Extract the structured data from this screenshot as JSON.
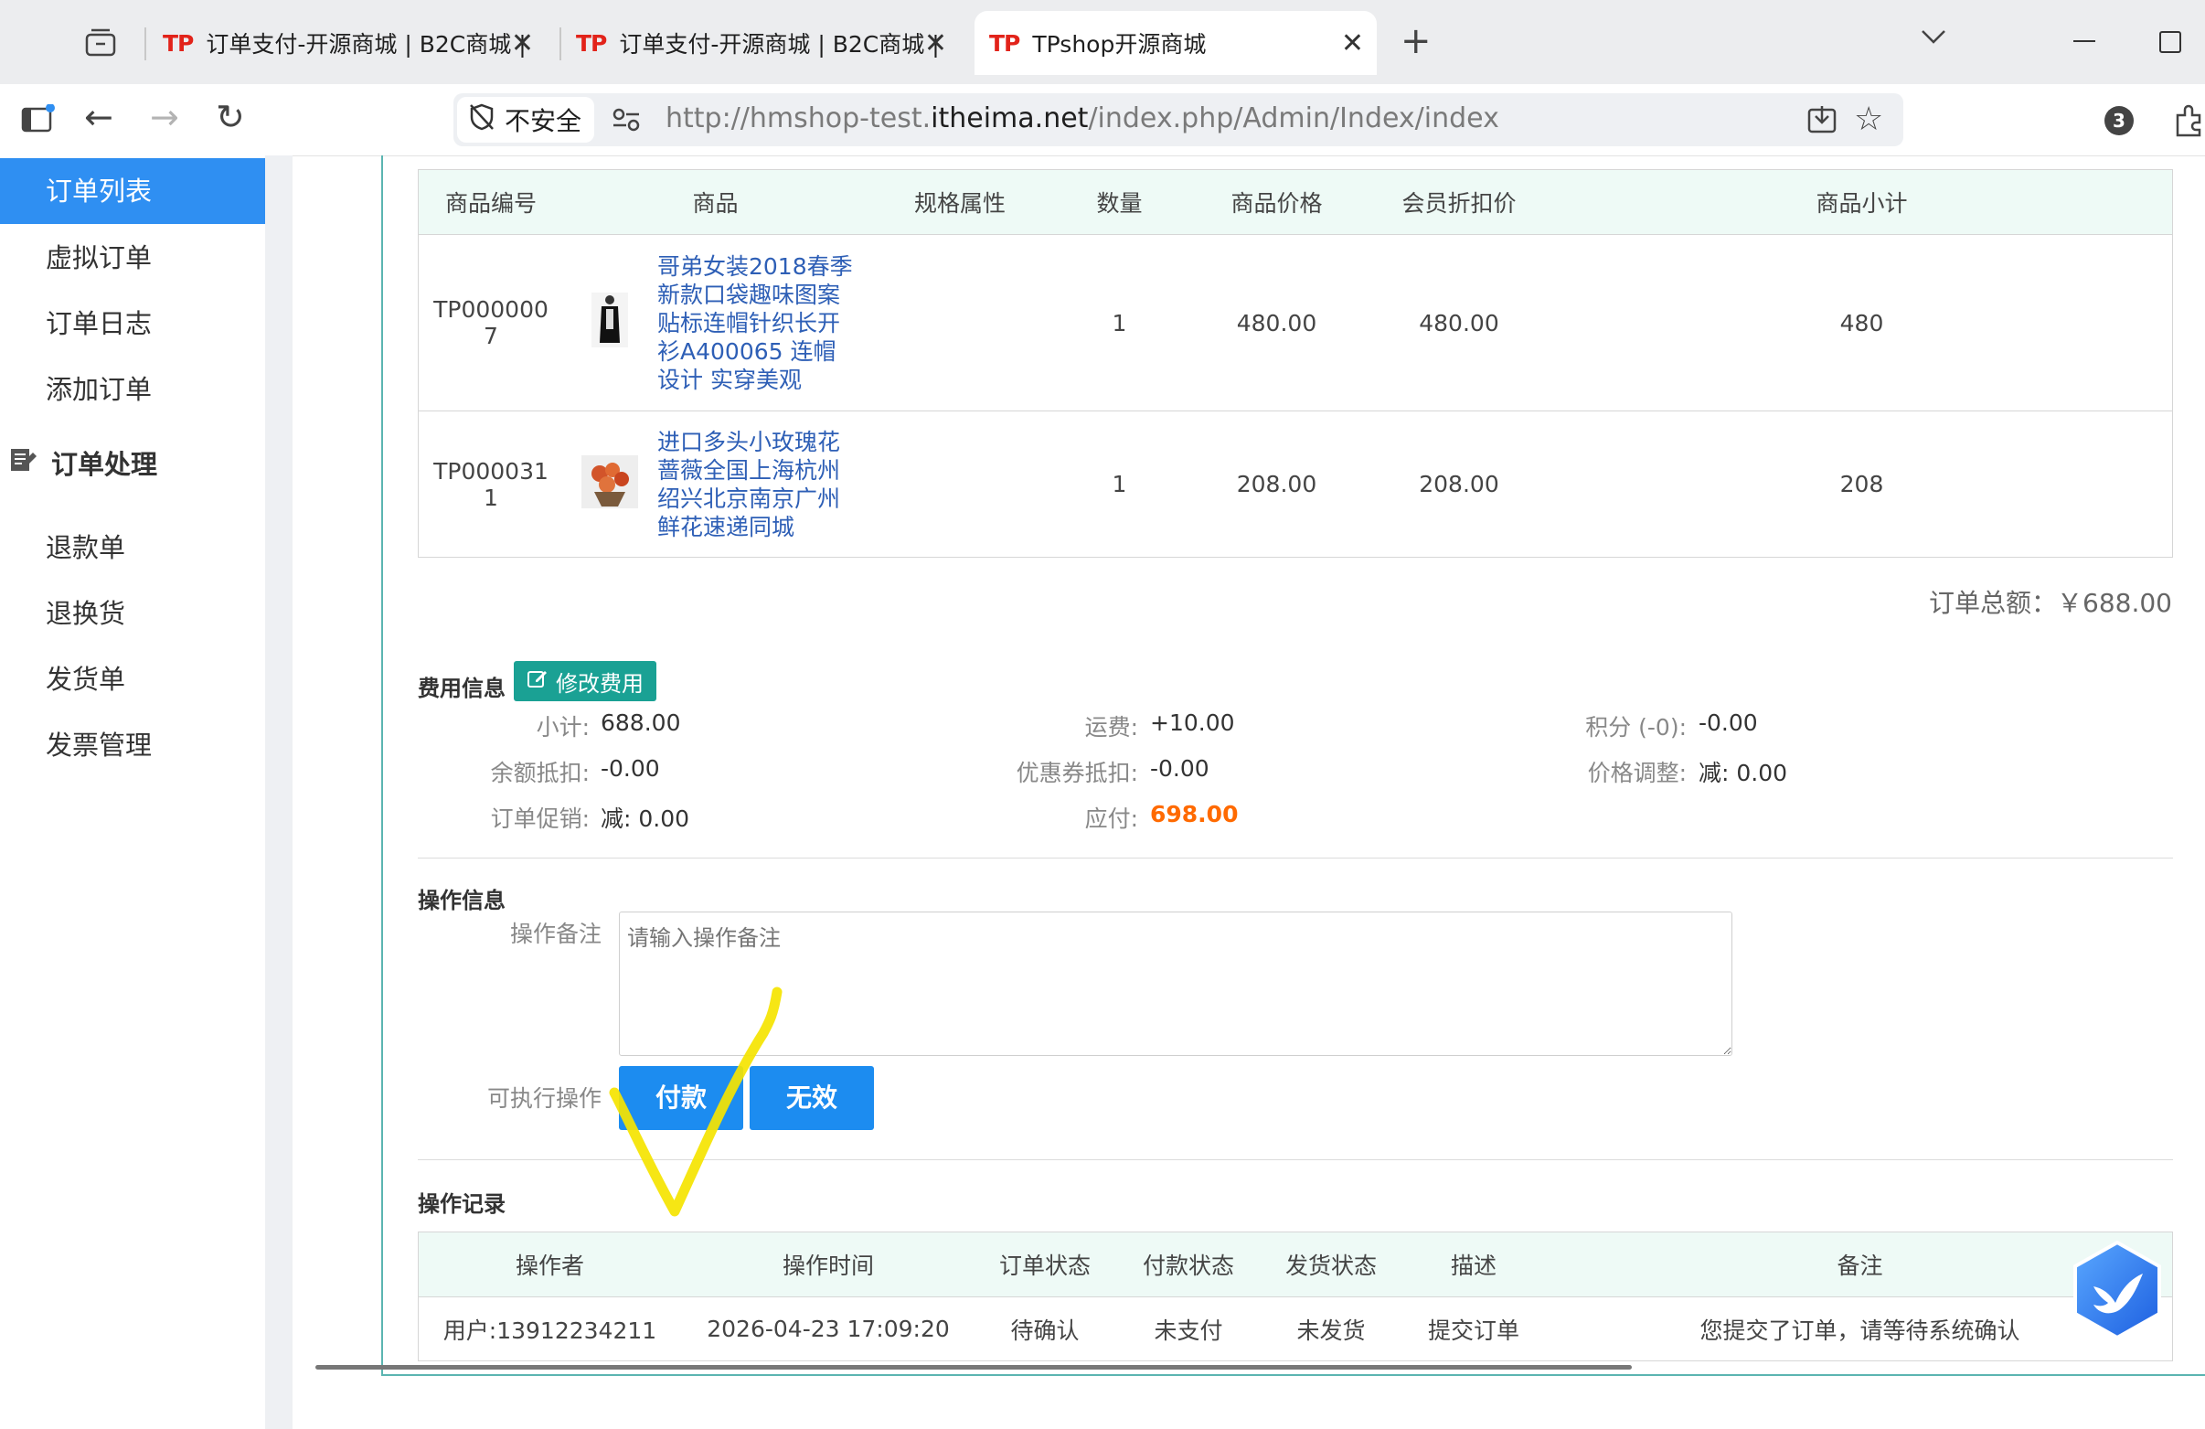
{
  "browser": {
    "tabs": [
      {
        "icon": "TP",
        "title": "订单支付-开源商城 | B2C商城 |",
        "active": false
      },
      {
        "icon": "TP",
        "title": "订单支付-开源商城 | B2C商城 |",
        "active": false
      },
      {
        "icon": "TP",
        "title": "TPshop开源商城",
        "active": true
      }
    ],
    "security_label": "不安全",
    "url_prefix": "http://hmshop-test.",
    "url_domain": "itheima.net",
    "url_path": "/index.php/Admin/Index/index",
    "extension_badge": "3"
  },
  "sidebar": {
    "items_top": [
      "订单列表",
      "虚拟订单",
      "订单日志",
      "添加订单"
    ],
    "section_title": "订单处理",
    "items_bottom": [
      "退款单",
      "退换货",
      "发货单",
      "发票管理"
    ]
  },
  "goods_table": {
    "headers": [
      "商品编号",
      "商品",
      "规格属性",
      "数量",
      "商品价格",
      "会员折扣价",
      "商品小计"
    ],
    "rows": [
      {
        "sn_line1": "TP000000",
        "sn_line2": "7",
        "image": "clothing-thumbnail",
        "name": "哥弟女装2018春季新款口袋趣味图案贴标连帽针织长开衫A400065 连帽设计 实穿美观",
        "spec": "",
        "qty": "1",
        "price": "480.00",
        "member_price": "480.00",
        "subtotal": "480"
      },
      {
        "sn_line1": "TP000031",
        "sn_line2": "1",
        "image": "flower-bouquet-thumbnail",
        "name": "进口多头小玫瑰花蔷薇全国上海杭州绍兴北京南京广州鲜花速递同城",
        "spec": "",
        "qty": "1",
        "price": "208.00",
        "member_price": "208.00",
        "subtotal": "208"
      }
    ],
    "total_label": "订单总额：",
    "total_value": "￥688.00"
  },
  "fees": {
    "title": "费用信息",
    "edit_button": "修改费用",
    "subtotal_label": "小计:",
    "subtotal_value": "688.00",
    "shipping_label": "运费:",
    "shipping_value": "+10.00",
    "points_label": "积分 (-0):",
    "points_value": "-0.00",
    "balance_label": "余额抵扣:",
    "balance_value": "-0.00",
    "coupon_label": "优惠券抵扣:",
    "coupon_value": "-0.00",
    "adjust_label": "价格调整:",
    "adjust_value": "减: 0.00",
    "promo_label": "订单促销:",
    "promo_value": "减: 0.00",
    "payable_label": "应付:",
    "payable_value": "698.00"
  },
  "operation": {
    "title": "操作信息",
    "remark_label": "操作备注",
    "remark_placeholder": "请输入操作备注",
    "actions_label": "可执行操作",
    "pay_button": "付款",
    "invalid_button": "无效"
  },
  "log": {
    "title": "操作记录",
    "headers": [
      "操作者",
      "操作时间",
      "订单状态",
      "付款状态",
      "发货状态",
      "描述",
      "备注"
    ],
    "rows": [
      {
        "operator": "用户:13912234211",
        "time": "2026-04-23 17:09:20",
        "order_status": "待确认",
        "pay_status": "未支付",
        "ship_status": "未发货",
        "desc": "提交订单",
        "note": "您提交了订单，请等待系统确认"
      }
    ]
  },
  "colors": {
    "accent": "#2f8ff2",
    "teal": "#1aa194",
    "payable": "#ff6a00",
    "annotation": "#f5e400"
  }
}
